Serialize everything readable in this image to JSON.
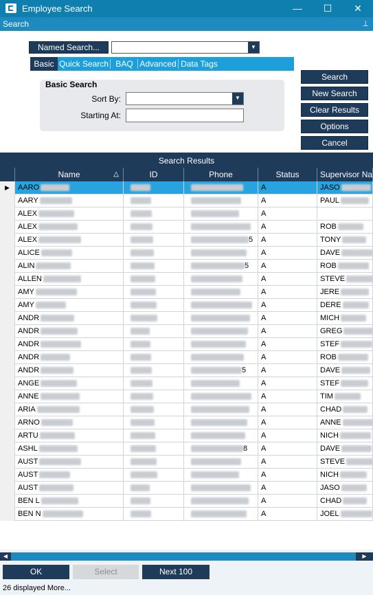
{
  "window": {
    "title": "Employee Search",
    "minimize": "—",
    "maximize": "☐",
    "close": "✕"
  },
  "search_bar": {
    "label": "Search",
    "pin": "⊥"
  },
  "named_search": {
    "button_label": "Named Search...",
    "value": ""
  },
  "tabs": [
    {
      "label": "Basic",
      "active": true
    },
    {
      "label": "Quick Search",
      "active": false
    },
    {
      "label": "BAQ",
      "active": false
    },
    {
      "label": "Advanced",
      "active": false
    },
    {
      "label": "Data Tags",
      "active": false
    }
  ],
  "basic_search": {
    "title": "Basic Search",
    "sort_by_label": "Sort By:",
    "sort_by_value": "",
    "starting_at_label": "Starting At:",
    "starting_at_value": ""
  },
  "action_buttons": {
    "search": "Search",
    "new_search": "New Search",
    "clear_results": "Clear Results",
    "options": "Options",
    "cancel": "Cancel"
  },
  "results": {
    "title": "Search Results",
    "columns": [
      "Name",
      "ID",
      "Phone",
      "Status",
      "Supervisor Nar"
    ],
    "rows": [
      {
        "name": "AARO",
        "phone": "",
        "status": "A",
        "supervisor": "JASO",
        "selected": true
      },
      {
        "name": "AARY",
        "phone": "",
        "status": "A",
        "supervisor": "PAUL",
        "selected": false
      },
      {
        "name": "ALEX",
        "phone": "",
        "status": "A",
        "supervisor": "",
        "selected": false
      },
      {
        "name": "ALEX",
        "phone": "",
        "status": "A",
        "supervisor": "ROB",
        "selected": false
      },
      {
        "name": "ALEX",
        "phone": "5",
        "status": "A",
        "supervisor": "TONY",
        "selected": false
      },
      {
        "name": "ALICE",
        "phone": "",
        "status": "A",
        "supervisor": "DAVE",
        "selected": false
      },
      {
        "name": "ALIN",
        "phone": "5",
        "status": "A",
        "supervisor": "ROB",
        "selected": false
      },
      {
        "name": "ALLEN",
        "phone": "",
        "status": "A",
        "supervisor": "STEVE",
        "selected": false
      },
      {
        "name": "AMY",
        "phone": "",
        "status": "A",
        "supervisor": "JERE",
        "selected": false
      },
      {
        "name": "AMY",
        "phone": "",
        "status": "A",
        "supervisor": "DERE",
        "selected": false
      },
      {
        "name": "ANDR",
        "phone": "",
        "status": "A",
        "supervisor": "MICH",
        "selected": false
      },
      {
        "name": "ANDR",
        "phone": "",
        "status": "A",
        "supervisor": "GREG",
        "selected": false
      },
      {
        "name": "ANDR",
        "phone": "",
        "status": "A",
        "supervisor": "STEF",
        "selected": false
      },
      {
        "name": "ANDR",
        "phone": "",
        "status": "A",
        "supervisor": "ROB",
        "selected": false
      },
      {
        "name": "ANDR",
        "phone": "5",
        "status": "A",
        "supervisor": "DAVE",
        "selected": false
      },
      {
        "name": "ANGE",
        "phone": "",
        "status": "A",
        "supervisor": "STEF",
        "selected": false
      },
      {
        "name": "ANNE",
        "phone": "",
        "status": "A",
        "supervisor": "TIM",
        "selected": false
      },
      {
        "name": "ARIA",
        "phone": "",
        "status": "A",
        "supervisor": "CHAD",
        "selected": false
      },
      {
        "name": "ARNO",
        "phone": "",
        "status": "A",
        "supervisor": "ANNE",
        "selected": false
      },
      {
        "name": "ARTU",
        "phone": "",
        "status": "A",
        "supervisor": "NICH",
        "selected": false
      },
      {
        "name": "ASHL",
        "phone": "8",
        "status": "A",
        "supervisor": "DAVE",
        "selected": false
      },
      {
        "name": "AUST",
        "phone": "",
        "status": "A",
        "supervisor": "STEVE",
        "selected": false
      },
      {
        "name": "AUST",
        "phone": "",
        "status": "A",
        "supervisor": "NICH",
        "selected": false
      },
      {
        "name": "AUST",
        "phone": "",
        "status": "A",
        "supervisor": "JASO",
        "selected": false
      },
      {
        "name": "BEN L",
        "phone": "",
        "status": "A",
        "supervisor": "CHAD",
        "selected": false
      },
      {
        "name": "BEN N",
        "phone": "",
        "status": "A",
        "supervisor": "JOEL",
        "selected": false
      }
    ]
  },
  "bottom_buttons": {
    "ok": "OK",
    "select": "Select",
    "next": "Next 100"
  },
  "status_text": "26 displayed More...",
  "colors": {
    "title_bar": "#0f7fb0",
    "dark_navy": "#1f3b5a",
    "tab_blue": "#1d9fdb",
    "selected_row": "#29a3df"
  },
  "icons": {
    "app": "epicor-e-icon",
    "pin": "pin-icon",
    "row_selector": "row-pointer-icon",
    "sort": "sort-asc-icon"
  }
}
